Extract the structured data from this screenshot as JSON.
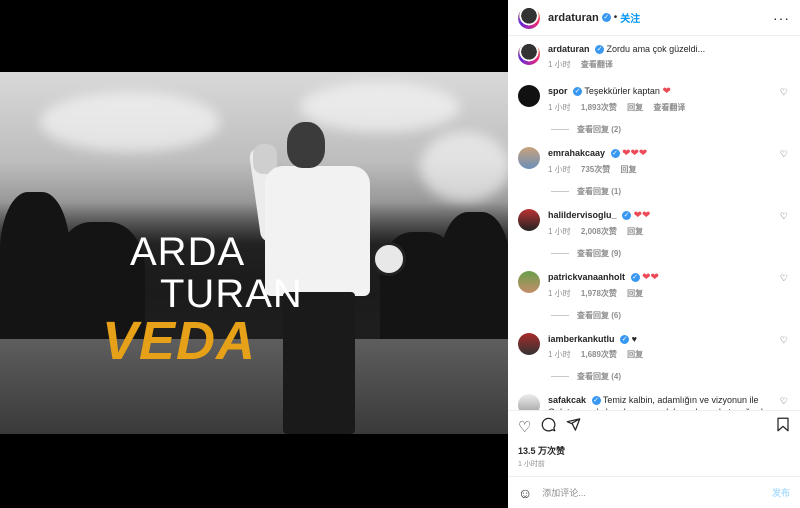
{
  "media": {
    "line1": "ARDA",
    "line2": "TURAN",
    "line3": "VEDA"
  },
  "header": {
    "username": "ardaturan",
    "dot": "•",
    "follow_label": "关注",
    "more": "···"
  },
  "caption": {
    "username": "ardaturan",
    "text": "Zordu ama çok güzeldi...",
    "time": "1 小时",
    "translate": "查看翻译"
  },
  "comments": [
    {
      "username": "spor",
      "text": "Teşekkürler kaptan",
      "hearts": "❤",
      "time": "1 小时",
      "likes": "1,893次赞",
      "reply": "回复",
      "translate": "查看翻译",
      "replies": "查看回复 (2)"
    },
    {
      "username": "emrahakcaay",
      "text": "",
      "hearts": "❤❤❤",
      "time": "1 小时",
      "likes": "735次赞",
      "reply": "回复",
      "translate": "",
      "replies": "查看回复 (1)"
    },
    {
      "username": "halildervisoglu_",
      "text": "",
      "hearts": "❤❤",
      "time": "1 小时",
      "likes": "2,008次赞",
      "reply": "回复",
      "translate": "",
      "replies": "查看回复 (9)"
    },
    {
      "username": "patrickvanaanholt",
      "text": "",
      "hearts": "❤❤",
      "time": "1 小时",
      "likes": "1,978次赞",
      "reply": "回复",
      "translate": "",
      "replies": "查看回复 (6)"
    },
    {
      "username": "iamberkankutlu",
      "text": "",
      "hearts": "♥",
      "time": "1 小时",
      "likes": "1,689次赞",
      "reply": "回复",
      "translate": "",
      "replies": "查看回复 (4)"
    },
    {
      "username": "safakcak",
      "text": "Temiz kalbin, adamlığın ve vizyonun ile Galatasaray'a bundan sonra daha çok şey katacağından hiçbir şüphem yok 👏😊 İlk devre bitti, ikinci yarı başlıyor 👏",
      "hearts": "",
      "time": "",
      "likes": "",
      "reply": "",
      "translate": "",
      "replies": ""
    }
  ],
  "actions": {
    "like_icon": "heart-icon",
    "comment_icon": "comment-icon",
    "share_icon": "share-icon",
    "save_icon": "bookmark-icon"
  },
  "likes": "13.5 万次赞",
  "posted_time": "1 小时前",
  "add_comment": {
    "placeholder": "添加评论...",
    "post_label": "发布"
  },
  "colors": {
    "accent": "#0095f6",
    "veda": "#e6a118",
    "verified": "#3897f0",
    "heart": "#ed4956"
  }
}
